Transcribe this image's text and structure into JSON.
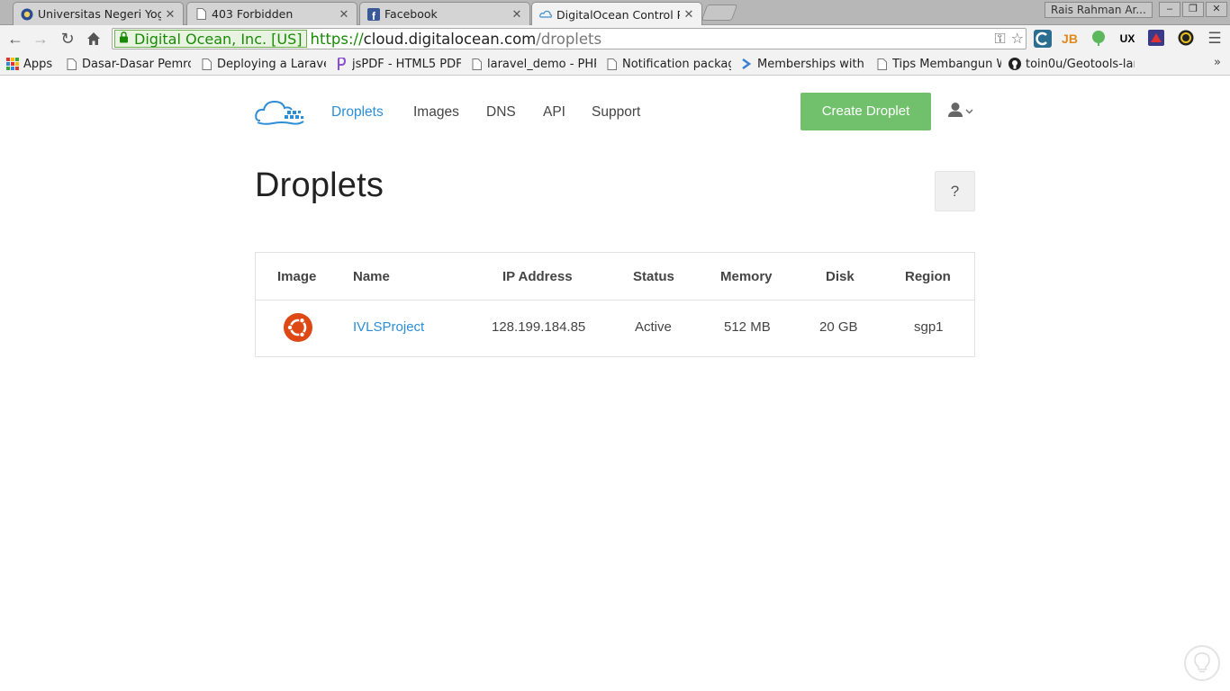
{
  "browser": {
    "tabs": [
      {
        "title": "Universitas Negeri Yogy",
        "icon": "university-icon"
      },
      {
        "title": "403 Forbidden",
        "icon": "page-icon"
      },
      {
        "title": "Facebook",
        "icon": "facebook-icon"
      },
      {
        "title": "DigitalOcean Control Pa",
        "icon": "digitalocean-icon"
      }
    ],
    "profile_name": "Rais Rahman Ar...",
    "ev_cert": "Digital Ocean, Inc. [US]",
    "url": {
      "scheme": "https://",
      "host": "cloud.digitalocean.com",
      "path": "/droplets"
    },
    "bookmarks": [
      {
        "label": "Apps",
        "icon": "apps-grid-icon"
      },
      {
        "label": "Dasar-Dasar Pemrog",
        "icon": "page-icon"
      },
      {
        "label": "Deploying a Laravel",
        "icon": "page-icon"
      },
      {
        "label": "jsPDF - HTML5 PDF",
        "icon": "jspdf-icon"
      },
      {
        "label": "laravel_demo - PHP",
        "icon": "page-icon"
      },
      {
        "label": "Notification packag",
        "icon": "page-icon"
      },
      {
        "label": "Memberships with",
        "icon": "arrow-icon"
      },
      {
        "label": "Tips Membangun W",
        "icon": "page-icon"
      },
      {
        "label": "toin0u/Geotools-lara",
        "icon": "github-icon"
      }
    ],
    "bookmarks_more": "»"
  },
  "header": {
    "nav": [
      {
        "label": "Droplets",
        "active": true
      },
      {
        "label": "Images",
        "active": false
      },
      {
        "label": "DNS",
        "active": false
      },
      {
        "label": "API",
        "active": false
      },
      {
        "label": "Support",
        "active": false
      }
    ],
    "create_button": "Create Droplet"
  },
  "main": {
    "title": "Droplets",
    "help_label": "?",
    "table": {
      "columns": [
        "Image",
        "Name",
        "IP Address",
        "Status",
        "Memory",
        "Disk",
        "Region"
      ],
      "rows": [
        {
          "image": "ubuntu-icon",
          "name": "IVLSProject",
          "ip": "128.199.184.85",
          "status": "Active",
          "memory": "512 MB",
          "disk": "20 GB",
          "region": "sgp1"
        }
      ]
    }
  },
  "colors": {
    "accent": "#2c8ed6",
    "create_button": "#71c16c",
    "ubuntu": "#dd4814"
  }
}
